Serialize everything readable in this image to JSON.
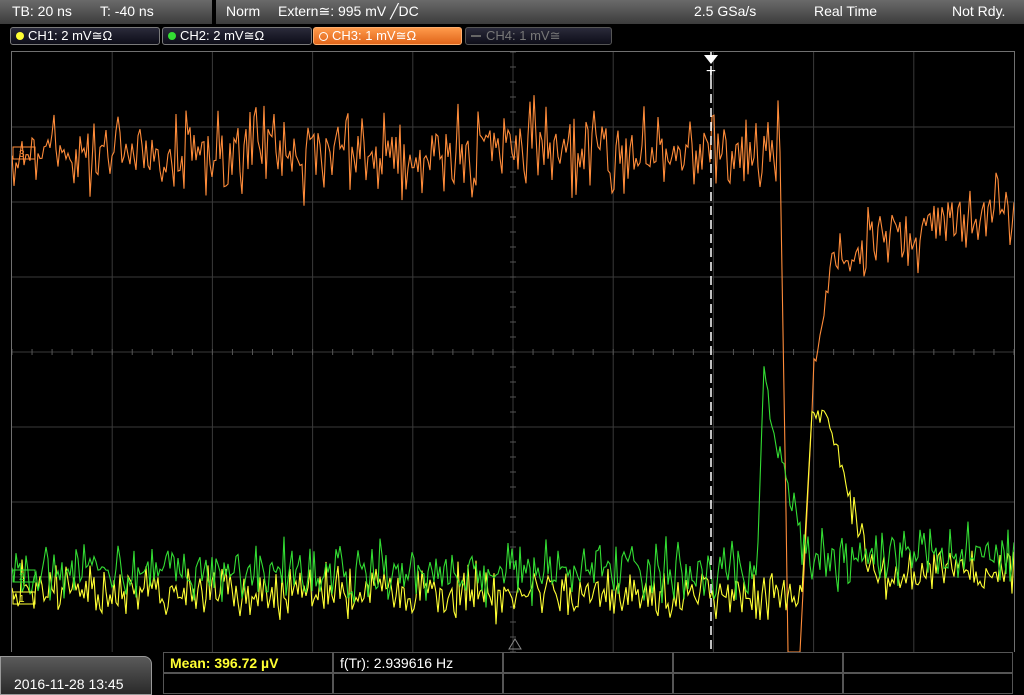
{
  "status": {
    "timebase": "TB: 20 ns",
    "trigger_time": "T: -40 ns",
    "mode": "Norm",
    "trigger_source": "Extern≅: 995 mV ╱DC",
    "sample_rate": "2.5 GSa/s",
    "acq_mode": "Real Time",
    "state": "Not Rdy."
  },
  "channels": [
    {
      "label": "CH1: 2 mV≅Ω",
      "color": "#ffff33",
      "active": false,
      "enabled": true
    },
    {
      "label": "CH2: 2 mV≅Ω",
      "color": "#33dd33",
      "active": false,
      "enabled": true
    },
    {
      "label": "CH3: 1 mV≅Ω",
      "color": "#ff8c3a",
      "active": true,
      "enabled": true
    },
    {
      "label": "CH4: 1 mV≅",
      "color": "#555555",
      "active": false,
      "enabled": false
    }
  ],
  "markers": {
    "ch3": "3",
    "ch2": "2",
    "ch1": "1",
    "trigger": "T"
  },
  "bottom": {
    "datetime": "2016-11-28 13:45",
    "measurements": [
      {
        "label": "Mean: 396.72 µV",
        "color": "#ffff33"
      },
      {
        "label": "f(Tr): 2.939616 Hz",
        "color": "#ffffff"
      }
    ]
  },
  "colors": {
    "ch1": "#ffff33",
    "ch2": "#33dd33",
    "ch3": "#ff8c3a",
    "grid": "#3a3a3a"
  }
}
